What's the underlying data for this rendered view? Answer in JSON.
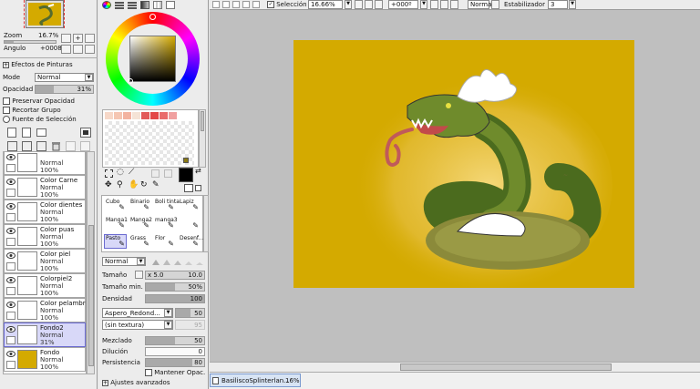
{
  "navigator": {
    "zoom_label": "Zoom",
    "zoom_value": "16.7%",
    "angle_label": "Angulo",
    "angle_value": "+0008"
  },
  "layer_panel": {
    "effects_label": "Efectos de Pinturas",
    "mode_label": "Mode",
    "mode_value": "Normal",
    "opacity_label": "Opacidad",
    "opacity_value": "31%",
    "opacity_fraction": 0.31,
    "preserve_opacity": "Preservar Opacidad",
    "clip_group": "Recortar Grupo",
    "selection_source": "Fuente de Selección",
    "layers": [
      {
        "name": "",
        "mode": "Normal",
        "opacity": "100%"
      },
      {
        "name": "Color Carne",
        "mode": "Normal",
        "opacity": "100%"
      },
      {
        "name": "Color dientes",
        "mode": "Normal",
        "opacity": "100%"
      },
      {
        "name": "Color puas",
        "mode": "Normal",
        "opacity": "100%"
      },
      {
        "name": "Color piel",
        "mode": "Normal",
        "opacity": "100%"
      },
      {
        "name": "Colorpiel2",
        "mode": "Normal",
        "opacity": "100%"
      },
      {
        "name": "Color pelambre",
        "mode": "Normal",
        "opacity": "100%"
      },
      {
        "name": "Fondo2",
        "mode": "Normal",
        "opacity": "31%"
      },
      {
        "name": "Fondo",
        "mode": "Normal",
        "opacity": "100%"
      }
    ]
  },
  "colors": {
    "background": "#d4aa00",
    "swatches": [
      "#f7d8c8",
      "#f5c6b2",
      "#f3b3a0",
      "#f5e3d6",
      "#e25a5a",
      "#e34848",
      "#e96b6b",
      "#f0a0a0"
    ],
    "foreground_color": "#000000",
    "background_color": "#ffffff",
    "small_swatch": "#8b7a12"
  },
  "brushes": {
    "row1": [
      "Cubo",
      "Binario",
      "Boli tinta",
      "Lapiz"
    ],
    "row2": [
      "Manga1",
      "Manga2",
      "manga3",
      ""
    ],
    "row3": [
      "Pasto",
      "Grass",
      "Flor",
      "Desenf..."
    ]
  },
  "brush_settings": {
    "blend_mode": "Normal",
    "size_label": "Tamaño",
    "size_mult": "x 5.0",
    "size_value": "10.0",
    "min_size_label": "Tamaño min.",
    "min_size_value": "50%",
    "min_size_fraction": 0.5,
    "density_label": "Densidad",
    "density_value": "100",
    "density_fraction": 1.0,
    "shape": "Aspero_Redond...",
    "shape_value": "50",
    "texture": "(sin textura)",
    "texture_value": "95",
    "mix_label": "Mezclado",
    "mix_value": "50",
    "mix_fraction": 0.5,
    "dilution_label": "Dilución",
    "dilution_value": "0",
    "dilution_fraction": 0,
    "persistence_label": "Persistencia",
    "persistence_value": "80",
    "persistence_fraction": 0.8,
    "keep_opacity": "Mantener Opac.",
    "advanced": "Ajustes avanzados"
  },
  "toolbar": {
    "selection_label": "Selección",
    "zoom_value": "16.66%",
    "angle_value": "+000º",
    "mode_value": "Normal",
    "stabilizer_label": "Estabilizador",
    "stabilizer_value": "3"
  },
  "status": {
    "tab_name": "BasiliscoSplinterlan...",
    "tab_zoom": "16%"
  }
}
